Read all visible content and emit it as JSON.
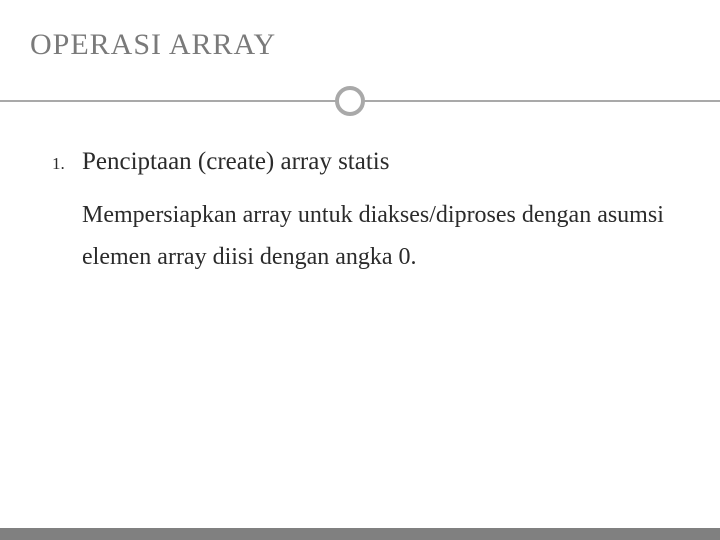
{
  "slide": {
    "title": "OPERASI ARRAY",
    "list": {
      "number": "1.",
      "heading": "Penciptaan (create) array statis",
      "body": "Mempersiapkan array untuk diakses/diproses dengan asumsi elemen array diisi dengan angka 0."
    }
  }
}
